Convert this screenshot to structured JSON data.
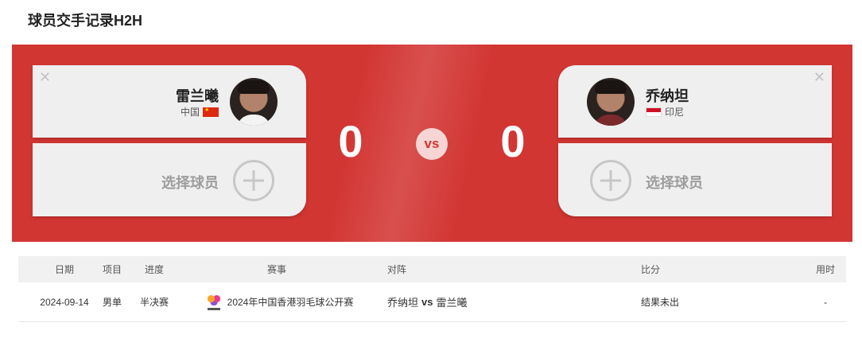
{
  "page": {
    "title": "球员交手记录H2H"
  },
  "left_player": {
    "name": "雷兰曦",
    "country": "中国",
    "score": "0",
    "close_icon": "✕",
    "flag_icon": "china-flag-icon"
  },
  "right_player": {
    "name": "乔纳坦",
    "country": "印尼",
    "score": "0",
    "close_icon": "✕",
    "flag_icon": "indonesia-flag-icon"
  },
  "vs_badge": "vs",
  "select_player_label": "选择球员",
  "colors": {
    "banner": "#d23633",
    "card": "#efefef",
    "vs_badge_bg": "#f6d5d4"
  },
  "table": {
    "headers": {
      "date": "日期",
      "event": "项目",
      "round": "进度",
      "tournament": "赛事",
      "matchup": "对阵",
      "score": "比分",
      "duration": "用时"
    },
    "rows": [
      {
        "date": "2024-09-14",
        "event": "男单",
        "round": "半决赛",
        "tournament": "2024年中国香港羽毛球公开赛",
        "player_a": "乔纳坦",
        "vs": "vs",
        "player_b": "雷兰曦",
        "score": "结果未出",
        "duration": "-"
      }
    ]
  }
}
